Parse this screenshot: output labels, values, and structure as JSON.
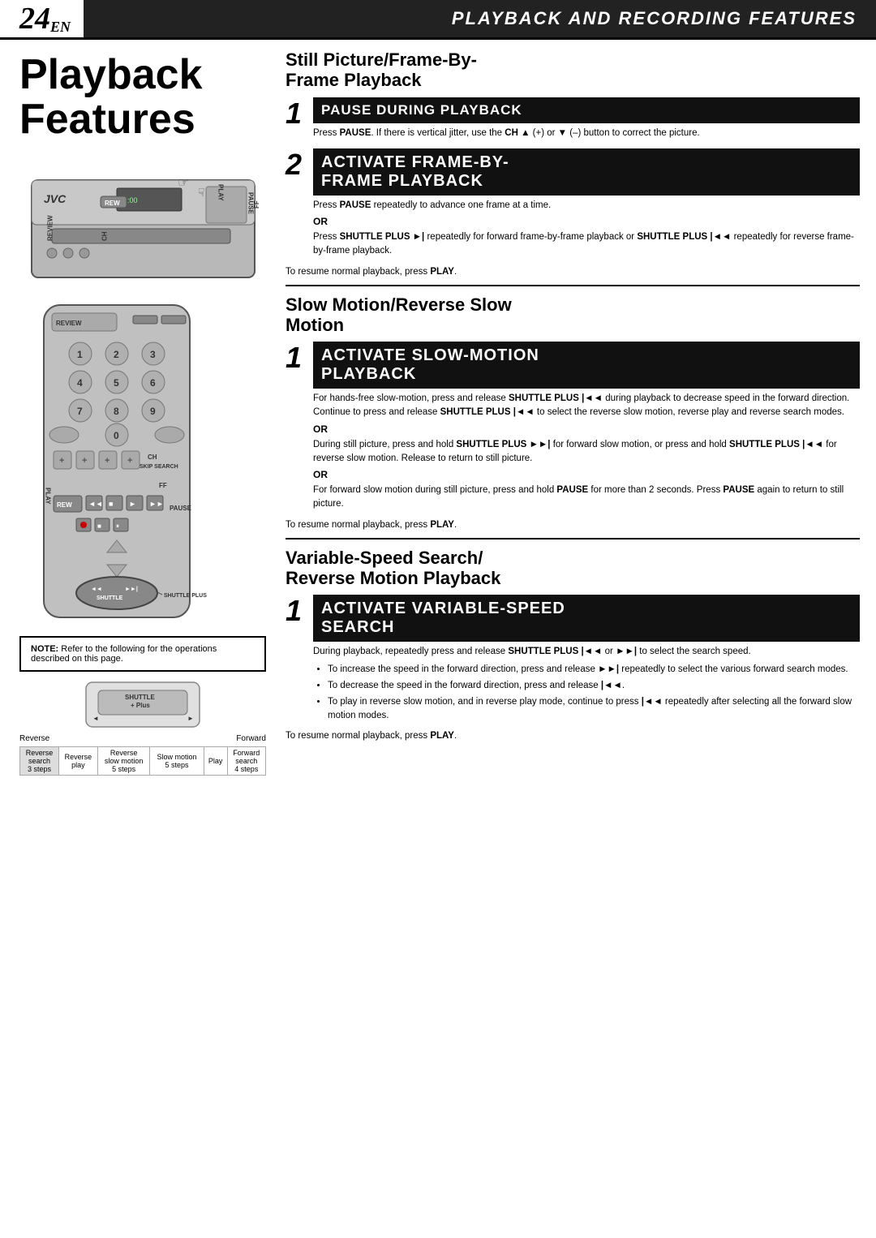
{
  "header": {
    "page_number": "24",
    "page_en": "EN",
    "title": "PLAYBACK AND RECORDING FEATURES"
  },
  "page_heading": "Playback\nFeatures",
  "sections": {
    "still_picture": {
      "heading": "Still Picture/Frame-By-\nFrame Playback",
      "step1": {
        "header": "PAUSE DURING PLAYBACK",
        "number": "1",
        "text": "Press PAUSE. If there is vertical jitter, use the CH ▲ (+) or ▼ (–) button to correct the picture."
      },
      "step2": {
        "header_line1": "ACTIVATE FRAME-BY-",
        "header_line2": "FRAME PLAYBACK",
        "number": "2",
        "text1": "Press PAUSE repeatedly to advance one frame at a time.",
        "or1": "OR",
        "text2": "Press SHUTTLE PLUS ►| repeatedly for forward frame-by-frame playback or SHUTTLE PLUS |◄◄ repeatedly for reverse frame-by-frame playback.",
        "resume": "To resume normal playback, press PLAY."
      }
    },
    "slow_motion": {
      "heading": "Slow Motion/Reverse Slow\nMotion",
      "step1": {
        "header_line1": "ACTIVATE SLOW-MOTION",
        "header_line2": "PLAYBACK",
        "number": "1",
        "text1": "For hands-free slow-motion, press and release SHUTTLE PLUS |◄◄ during playback to decrease speed in the forward direction. Continue to press and release SHUTTLE PLUS |◄◄ to select the reverse slow motion, reverse play and reverse search modes.",
        "or1": "OR",
        "text2": "During still picture, press and hold SHUTTLE PLUS ►►| for forward slow motion, or press and hold SHUTTLE PLUS |◄◄ for reverse slow motion. Release to return to still picture.",
        "or2": "OR",
        "text3": "For forward slow motion during still picture, press and hold PAUSE for more than 2 seconds. Press PAUSE again to return to still picture.",
        "resume": "To resume normal playback, press PLAY."
      }
    },
    "variable_speed": {
      "heading": "Variable-Speed Search/\nReverse Motion Playback",
      "step1": {
        "header_line1": "ACTIVATE VARIABLE-SPEED",
        "header_line2": "SEARCH",
        "number": "1",
        "text1": "During playback, repeatedly press and release SHUTTLE PLUS |◄◄ or ►►| to select the search speed.",
        "bullets": [
          "To increase the speed in the forward direction, press and release ►►| repeatedly to select the various forward search modes.",
          "To decrease the speed in the forward direction, press and release |◄◄.",
          "To play in reverse slow motion, and in reverse play mode, continue to press |◄◄ repeatedly after selecting all the forward slow motion modes."
        ],
        "resume": "To resume normal playback, press PLAY."
      }
    }
  },
  "note": {
    "prefix": "NOTE:",
    "text": "Refer to the following for the operations described on this page."
  },
  "shuttle_diagram": {
    "label": "SHUTTLE\n+ Plus",
    "left_label": "Reverse",
    "right_label": "Forward",
    "table": {
      "headers": [
        "Reverse\nsearch\n3 steps",
        "Reverse\nplay",
        "Reverse\nslow motion\n5 steps",
        "Slow motion\n5 steps",
        "Play",
        "Forward\nsearch\n4 steps"
      ]
    }
  },
  "remote_labels": {
    "review": "REVIEW",
    "rew": "REW",
    "ff": "FF",
    "play": "PLAY",
    "pause": "PAUSE",
    "ch": "CH",
    "skip_search": "SKIP SEARCH",
    "shuttle_plus": "SHUTTLE PLUS",
    "nums": [
      "1",
      "2",
      "3",
      "4",
      "5",
      "6",
      "7",
      "8",
      "9",
      "0"
    ],
    "vcr_logo": "JVC"
  }
}
